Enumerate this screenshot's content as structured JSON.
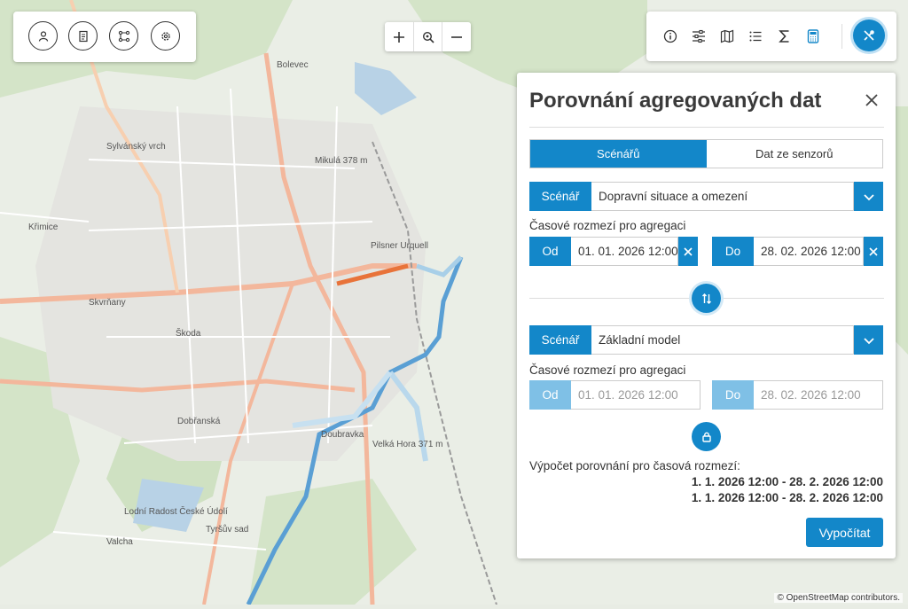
{
  "map": {
    "attribution": "© OpenStreetMap contributors.",
    "labels": [
      "Bolevec",
      "Sylvánský vrch",
      "Mikulá 378 m",
      "Křimice",
      "Skvrňany",
      "Škoda",
      "Pilsner Urquell",
      "Doubravka",
      "Velká Hora 371 m",
      "Doubravka",
      "Dobřanská",
      "Tyršův sad",
      "Lodní Radost České Údolí",
      "Valcha"
    ]
  },
  "toolbar_left": {
    "buttons": [
      {
        "icon": "user-icon"
      },
      {
        "icon": "document-icon"
      },
      {
        "icon": "network-icon"
      },
      {
        "icon": "settings-icon"
      }
    ]
  },
  "zoom": {
    "buttons": [
      {
        "icon": "zoom-in-icon",
        "glyph": "+"
      },
      {
        "icon": "zoom-extent-icon",
        "glyph": "⊕"
      },
      {
        "icon": "zoom-out-icon",
        "glyph": "−"
      }
    ]
  },
  "toolbar_right": {
    "icons": [
      "info-icon",
      "sliders-icon",
      "map-icon",
      "list-icon",
      "sigma-icon",
      "calculator-icon"
    ],
    "tools_icon": "tools-icon"
  },
  "panel": {
    "title": "Porovnání agregovaných dat",
    "tabs": [
      {
        "label": "Scénářů",
        "active": true
      },
      {
        "label": "Dat ze senzorů",
        "active": false
      }
    ],
    "first": {
      "scenario_label": "Scénář",
      "scenario_value": "Dopravní situace a omezení",
      "range_label": "Časové rozmezí pro agregaci",
      "from_label": "Od",
      "from_value": "01. 01. 2026 12:00",
      "to_label": "Do",
      "to_value": "28. 02. 2026 12:00"
    },
    "second": {
      "scenario_label": "Scénář",
      "scenario_value": "Základní model",
      "range_label": "Časové rozmezí pro agregaci",
      "from_label": "Od",
      "from_value": "01. 01. 2026 12:00",
      "to_label": "Do",
      "to_value": "28. 02. 2026 12:00"
    },
    "summary_label": "Výpočet porovnání pro časová rozmezí:",
    "summary_ranges": [
      "1. 1. 2026 12:00 - 28. 2. 2026 12:00",
      "1. 1. 2026 12:00 - 28. 2. 2026 12:00"
    ],
    "calculate_label": "Vypočítat",
    "accent": "#1387c9"
  }
}
